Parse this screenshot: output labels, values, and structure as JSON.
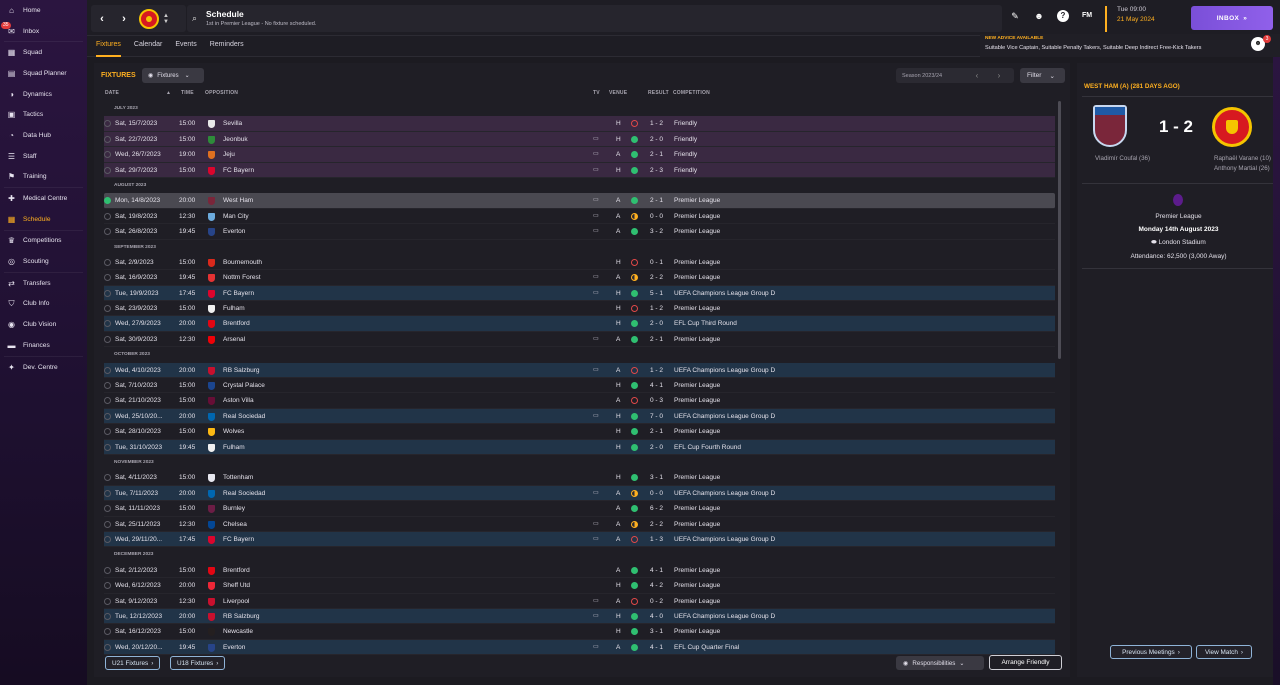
{
  "sidebar": {
    "items": [
      {
        "label": "Home",
        "icon": "home-icon",
        "glyph": "⌂"
      },
      {
        "label": "Inbox",
        "icon": "inbox-icon",
        "glyph": "✉",
        "badge": "35"
      },
      {
        "label": "Squad",
        "icon": "squad-icon",
        "glyph": "▦"
      },
      {
        "label": "Squad Planner",
        "icon": "squad-planner-icon",
        "glyph": "▤"
      },
      {
        "label": "Dynamics",
        "icon": "dynamics-icon",
        "glyph": "◑"
      },
      {
        "label": "Tactics",
        "icon": "tactics-icon",
        "glyph": "▣"
      },
      {
        "label": "Data Hub",
        "icon": "data-hub-icon",
        "glyph": "◔"
      },
      {
        "label": "Staff",
        "icon": "staff-icon",
        "glyph": "☰"
      },
      {
        "label": "Training",
        "icon": "training-icon",
        "glyph": "⚑"
      },
      {
        "label": "Medical Centre",
        "icon": "medical-icon",
        "glyph": "✚"
      },
      {
        "label": "Schedule",
        "icon": "schedule-icon",
        "glyph": "▦",
        "active": true
      },
      {
        "label": "Competitions",
        "icon": "trophy-icon",
        "glyph": "♛"
      },
      {
        "label": "Scouting",
        "icon": "scouting-icon",
        "glyph": "◎"
      },
      {
        "label": "Transfers",
        "icon": "transfers-icon",
        "glyph": "⇄"
      },
      {
        "label": "Club Info",
        "icon": "club-info-icon",
        "glyph": "⛉"
      },
      {
        "label": "Club Vision",
        "icon": "club-vision-icon",
        "glyph": "◉"
      },
      {
        "label": "Finances",
        "icon": "finances-icon",
        "glyph": "▬"
      },
      {
        "label": "Dev. Centre",
        "icon": "dev-centre-icon",
        "glyph": "✦"
      }
    ]
  },
  "header": {
    "title": "Schedule",
    "subtitle": "1st in Premier League - No fixture scheduled.",
    "date_time": "Tue 09:00",
    "date_day": "21 May 2024",
    "inbox_label": "INBOX",
    "fm_label": "FM"
  },
  "tabs": [
    "Fixtures",
    "Calendar",
    "Events",
    "Reminders"
  ],
  "advice": {
    "title": "NEW ADVICE AVAILABLE",
    "text": "Suitable Vice Captain, Suitable Penalty Takers, Suitable Deep Indirect Free-Kick Takers",
    "count": "3"
  },
  "fixtures": {
    "heading": "FIXTURES",
    "dropdown": "Fixtures",
    "season": "Season 2023/24",
    "filter": "Filter",
    "columns": {
      "date": "DATE",
      "time": "TIME",
      "opposition": "OPPOSITION",
      "tv": "TV",
      "venue": "VENUE",
      "result": "RESULT",
      "competition": "COMPETITION"
    },
    "sections": [
      {
        "month": "JULY 2023",
        "rows": [
          {
            "date": "Sat, 15/7/2023",
            "time": "15:00",
            "opp": "Sevilla",
            "crest": "#e8e8e8",
            "tv": "",
            "venue": "H",
            "outcome": "l",
            "result": "1 - 2",
            "comp": "Friendly",
            "kind": "friendly"
          },
          {
            "date": "Sat, 22/7/2023",
            "time": "15:00",
            "opp": "Jeonbuk",
            "crest": "#2e8b3a",
            "tv": "tv",
            "venue": "H",
            "outcome": "w",
            "result": "2 - 0",
            "comp": "Friendly",
            "kind": "friendly"
          },
          {
            "date": "Wed, 26/7/2023",
            "time": "19:00",
            "opp": "Jeju",
            "crest": "#e07020",
            "tv": "tv",
            "venue": "A",
            "outcome": "w",
            "result": "2 - 1",
            "comp": "Friendly",
            "kind": "friendly"
          },
          {
            "date": "Sat, 29/7/2023",
            "time": "15:00",
            "opp": "FC Bayern",
            "crest": "#dc052d",
            "tv": "tv",
            "venue": "H",
            "outcome": "w",
            "result": "2 - 3",
            "comp": "Friendly",
            "kind": "friendly"
          }
        ]
      },
      {
        "month": "AUGUST 2023",
        "rows": [
          {
            "date": "Mon, 14/8/2023",
            "time": "20:00",
            "opp": "West Ham",
            "crest": "#7a263a",
            "tv": "tv",
            "venue": "A",
            "outcome": "w",
            "result": "2 - 1",
            "comp": "Premier League",
            "kind": "selected"
          },
          {
            "date": "Sat, 19/8/2023",
            "time": "12:30",
            "opp": "Man City",
            "crest": "#6cabdd",
            "tv": "tv",
            "venue": "A",
            "outcome": "d",
            "result": "0 - 0",
            "comp": "Premier League",
            "kind": ""
          },
          {
            "date": "Sat, 26/8/2023",
            "time": "19:45",
            "opp": "Everton",
            "crest": "#274488",
            "tv": "tv",
            "venue": "A",
            "outcome": "w",
            "result": "3 - 2",
            "comp": "Premier League",
            "kind": ""
          }
        ]
      },
      {
        "month": "SEPTEMBER 2023",
        "rows": [
          {
            "date": "Sat, 2/9/2023",
            "time": "15:00",
            "opp": "Bournemouth",
            "crest": "#da291c",
            "tv": "",
            "venue": "H",
            "outcome": "l",
            "result": "0 - 1",
            "comp": "Premier League",
            "kind": ""
          },
          {
            "date": "Sat, 16/9/2023",
            "time": "19:45",
            "opp": "Nottm Forest",
            "crest": "#e53233",
            "tv": "tv",
            "venue": "A",
            "outcome": "d",
            "result": "2 - 2",
            "comp": "Premier League",
            "kind": ""
          },
          {
            "date": "Tue, 19/9/2023",
            "time": "17:45",
            "opp": "FC Bayern",
            "crest": "#dc052d",
            "tv": "tv",
            "venue": "H",
            "outcome": "w",
            "result": "5 - 1",
            "comp": "UEFA Champions League Group D",
            "kind": "ucl"
          },
          {
            "date": "Sat, 23/9/2023",
            "time": "15:00",
            "opp": "Fulham",
            "crest": "#f0f0f0",
            "tv": "",
            "venue": "H",
            "outcome": "l",
            "result": "1 - 2",
            "comp": "Premier League",
            "kind": ""
          },
          {
            "date": "Wed, 27/9/2023",
            "time": "20:00",
            "opp": "Brentford",
            "crest": "#e30613",
            "tv": "",
            "venue": "H",
            "outcome": "w",
            "result": "2 - 0",
            "comp": "EFL Cup Third Round",
            "kind": "ucl"
          },
          {
            "date": "Sat, 30/9/2023",
            "time": "12:30",
            "opp": "Arsenal",
            "crest": "#ef0107",
            "tv": "tv",
            "venue": "A",
            "outcome": "w",
            "result": "2 - 1",
            "comp": "Premier League",
            "kind": ""
          }
        ]
      },
      {
        "month": "OCTOBER 2023",
        "rows": [
          {
            "date": "Wed, 4/10/2023",
            "time": "20:00",
            "opp": "RB Salzburg",
            "crest": "#c8102e",
            "tv": "tv",
            "venue": "A",
            "outcome": "l",
            "result": "1 - 2",
            "comp": "UEFA Champions League Group D",
            "kind": "ucl"
          },
          {
            "date": "Sat, 7/10/2023",
            "time": "15:00",
            "opp": "Crystal Palace",
            "crest": "#1b458f",
            "tv": "",
            "venue": "H",
            "outcome": "w",
            "result": "4 - 1",
            "comp": "Premier League",
            "kind": ""
          },
          {
            "date": "Sat, 21/10/2023",
            "time": "15:00",
            "opp": "Aston Villa",
            "crest": "#670e36",
            "tv": "",
            "venue": "A",
            "outcome": "l",
            "result": "0 - 3",
            "comp": "Premier League",
            "kind": ""
          },
          {
            "date": "Wed, 25/10/20...",
            "time": "20:00",
            "opp": "Real Sociedad",
            "crest": "#0067b1",
            "tv": "tv",
            "venue": "H",
            "outcome": "w",
            "result": "7 - 0",
            "comp": "UEFA Champions League Group D",
            "kind": "ucl"
          },
          {
            "date": "Sat, 28/10/2023",
            "time": "15:00",
            "opp": "Wolves",
            "crest": "#fdb913",
            "tv": "",
            "venue": "H",
            "outcome": "w",
            "result": "2 - 1",
            "comp": "Premier League",
            "kind": ""
          },
          {
            "date": "Tue, 31/10/2023",
            "time": "19:45",
            "opp": "Fulham",
            "crest": "#f0f0f0",
            "tv": "",
            "venue": "H",
            "outcome": "w",
            "result": "2 - 0",
            "comp": "EFL Cup Fourth Round",
            "kind": "ucl"
          }
        ]
      },
      {
        "month": "NOVEMBER 2023",
        "rows": [
          {
            "date": "Sat, 4/11/2023",
            "time": "15:00",
            "opp": "Tottenham",
            "crest": "#e8e8f0",
            "tv": "",
            "venue": "H",
            "outcome": "w",
            "result": "3 - 1",
            "comp": "Premier League",
            "kind": ""
          },
          {
            "date": "Tue, 7/11/2023",
            "time": "20:00",
            "opp": "Real Sociedad",
            "crest": "#0067b1",
            "tv": "tv",
            "venue": "A",
            "outcome": "d",
            "result": "0 - 0",
            "comp": "UEFA Champions League Group D",
            "kind": "ucl"
          },
          {
            "date": "Sat, 11/11/2023",
            "time": "15:00",
            "opp": "Burnley",
            "crest": "#6c1d45",
            "tv": "",
            "venue": "A",
            "outcome": "w",
            "result": "6 - 2",
            "comp": "Premier League",
            "kind": ""
          },
          {
            "date": "Sat, 25/11/2023",
            "time": "12:30",
            "opp": "Chelsea",
            "crest": "#034694",
            "tv": "tv",
            "venue": "A",
            "outcome": "d",
            "result": "2 - 2",
            "comp": "Premier League",
            "kind": ""
          },
          {
            "date": "Wed, 29/11/20...",
            "time": "17:45",
            "opp": "FC Bayern",
            "crest": "#dc052d",
            "tv": "tv",
            "venue": "A",
            "outcome": "l",
            "result": "1 - 3",
            "comp": "UEFA Champions League Group D",
            "kind": "ucl"
          }
        ]
      },
      {
        "month": "DECEMBER 2023",
        "rows": [
          {
            "date": "Sat, 2/12/2023",
            "time": "15:00",
            "opp": "Brentford",
            "crest": "#e30613",
            "tv": "",
            "venue": "A",
            "outcome": "w",
            "result": "4 - 1",
            "comp": "Premier League",
            "kind": ""
          },
          {
            "date": "Wed, 6/12/2023",
            "time": "20:00",
            "opp": "Sheff Utd",
            "crest": "#ee2737",
            "tv": "",
            "venue": "H",
            "outcome": "w",
            "result": "4 - 2",
            "comp": "Premier League",
            "kind": ""
          },
          {
            "date": "Sat, 9/12/2023",
            "time": "12:30",
            "opp": "Liverpool",
            "crest": "#c8102e",
            "tv": "tv",
            "venue": "A",
            "outcome": "l",
            "result": "0 - 2",
            "comp": "Premier League",
            "kind": ""
          },
          {
            "date": "Tue, 12/12/2023",
            "time": "20:00",
            "opp": "RB Salzburg",
            "crest": "#c8102e",
            "tv": "tv",
            "venue": "H",
            "outcome": "w",
            "result": "4 - 0",
            "comp": "UEFA Champions League Group D",
            "kind": "ucl"
          },
          {
            "date": "Sat, 16/12/2023",
            "time": "15:00",
            "opp": "Newcastle",
            "crest": "#241f20",
            "tv": "",
            "venue": "H",
            "outcome": "w",
            "result": "3 - 1",
            "comp": "Premier League",
            "kind": ""
          },
          {
            "date": "Wed, 20/12/20...",
            "time": "19:45",
            "opp": "Everton",
            "crest": "#274488",
            "tv": "tv",
            "venue": "A",
            "outcome": "w",
            "result": "4 - 1",
            "comp": "EFL Cup Quarter Final",
            "kind": "ucl"
          }
        ]
      }
    ],
    "buttons": {
      "u21": "U21 Fixtures",
      "u18": "U18 Fixtures",
      "responsibilities": "Responsibilities",
      "arrange": "Arrange Friendly"
    }
  },
  "match": {
    "title": "WEST HAM (A) (281 DAYS AGO)",
    "score": "1 - 2",
    "home_scorers": [
      "Vladimír Coufal (36)"
    ],
    "away_scorers": [
      "Raphaël Varane (10)",
      "Anthony Martial (26)"
    ],
    "competition": "Premier League",
    "date": "Monday 14th August 2023",
    "stadium": "London Stadium",
    "attendance": "Attendance: 62,500 (3,000 Away)",
    "prev_meetings": "Previous Meetings",
    "view_match": "View Match"
  },
  "colors": {
    "accent": "#ffb020",
    "win": "#2fbf71",
    "loss": "#e04848",
    "draw": "#ffb020",
    "friendly_row": "#3a2942",
    "cup_row": "#213448",
    "inbox": "#8a5ae6"
  }
}
